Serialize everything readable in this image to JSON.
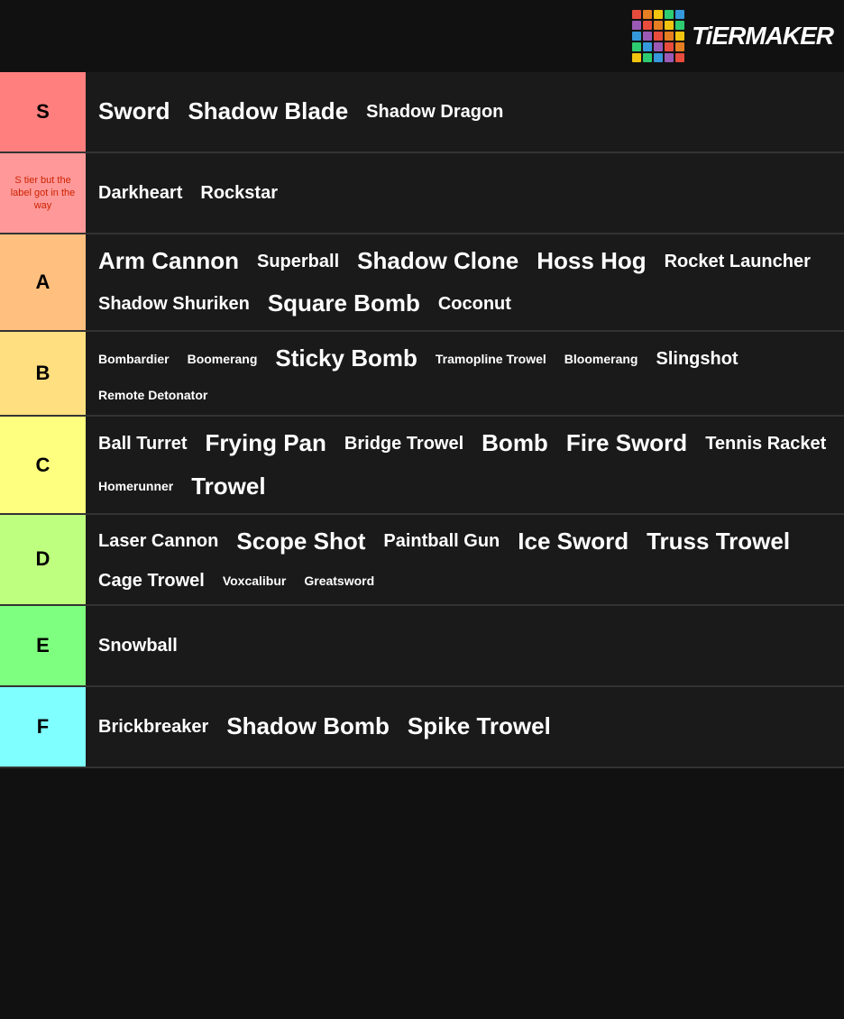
{
  "header": {
    "logo_text": "TiERMAKER",
    "logo_colors": [
      "#e74c3c",
      "#e67e22",
      "#f1c40f",
      "#2ecc71",
      "#3498db",
      "#9b59b6",
      "#e74c3c",
      "#e67e22",
      "#f1c40f",
      "#2ecc71",
      "#3498db",
      "#9b59b6",
      "#e74c3c",
      "#e67e22",
      "#f1c40f",
      "#2ecc71",
      "#3498db",
      "#9b59b6",
      "#e74c3c",
      "#e67e22",
      "#f1c40f",
      "#2ecc71",
      "#3498db",
      "#9b59b6",
      "#e74c3c"
    ]
  },
  "tiers": [
    {
      "id": "s",
      "label": "S",
      "color_class": "s-tier",
      "label_style": "normal",
      "items": [
        {
          "text": "Sword",
          "size": "large"
        },
        {
          "text": "Shadow Blade",
          "size": "large"
        },
        {
          "text": "Shadow Dragon",
          "size": "medium"
        }
      ]
    },
    {
      "id": "s-note",
      "label": "S tier but the label got in the way",
      "color_class": "s-tier-note",
      "label_style": "small",
      "items": [
        {
          "text": "Darkheart",
          "size": "medium"
        },
        {
          "text": "Rockstar",
          "size": "medium"
        }
      ]
    },
    {
      "id": "a",
      "label": "A",
      "color_class": "a-tier",
      "label_style": "normal",
      "items": [
        {
          "text": "Arm Cannon",
          "size": "large"
        },
        {
          "text": "Superball",
          "size": "medium"
        },
        {
          "text": "Shadow Clone",
          "size": "large"
        },
        {
          "text": "Hoss Hog",
          "size": "large"
        },
        {
          "text": "Rocket Launcher",
          "size": "medium"
        },
        {
          "text": "Shadow Shuriken",
          "size": "medium"
        },
        {
          "text": "Square Bomb",
          "size": "large"
        },
        {
          "text": "Coconut",
          "size": "medium"
        }
      ]
    },
    {
      "id": "b",
      "label": "B",
      "color_class": "b-tier",
      "label_style": "normal",
      "items": [
        {
          "text": "Bombardier",
          "size": "small"
        },
        {
          "text": "Boomerang",
          "size": "small"
        },
        {
          "text": "Sticky Bomb",
          "size": "large"
        },
        {
          "text": "Tramopline Trowel",
          "size": "small"
        },
        {
          "text": "Bloomerang",
          "size": "small"
        },
        {
          "text": "Slingshot",
          "size": "medium"
        },
        {
          "text": "Remote Detonator",
          "size": "small"
        }
      ]
    },
    {
      "id": "c",
      "label": "C",
      "color_class": "c-tier",
      "label_style": "normal",
      "items": [
        {
          "text": "Ball Turret",
          "size": "medium"
        },
        {
          "text": "Frying Pan",
          "size": "large"
        },
        {
          "text": "Bridge Trowel",
          "size": "medium"
        },
        {
          "text": "Bomb",
          "size": "large"
        },
        {
          "text": "Fire Sword",
          "size": "large"
        },
        {
          "text": "Tennis Racket",
          "size": "medium"
        },
        {
          "text": "Homerunner",
          "size": "small"
        },
        {
          "text": "Trowel",
          "size": "large"
        }
      ]
    },
    {
      "id": "d",
      "label": "D",
      "color_class": "d-tier",
      "label_style": "normal",
      "items": [
        {
          "text": "Laser Cannon",
          "size": "medium"
        },
        {
          "text": "Scope Shot",
          "size": "large"
        },
        {
          "text": "Paintball Gun",
          "size": "medium"
        },
        {
          "text": "Ice Sword",
          "size": "large"
        },
        {
          "text": "Truss Trowel",
          "size": "large"
        },
        {
          "text": "Cage Trowel",
          "size": "medium"
        },
        {
          "text": "Voxcalibur",
          "size": "small"
        },
        {
          "text": "Greatsword",
          "size": "small"
        }
      ]
    },
    {
      "id": "e",
      "label": "E",
      "color_class": "e-tier",
      "label_style": "normal",
      "items": [
        {
          "text": "Snowball",
          "size": "medium"
        }
      ]
    },
    {
      "id": "f",
      "label": "F",
      "color_class": "f-tier",
      "label_style": "normal",
      "items": [
        {
          "text": "Brickbreaker",
          "size": "medium"
        },
        {
          "text": "Shadow Bomb",
          "size": "large"
        },
        {
          "text": "Spike Trowel",
          "size": "large"
        }
      ]
    }
  ]
}
